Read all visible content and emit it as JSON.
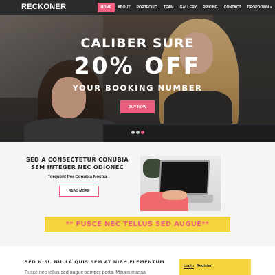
{
  "nav": {
    "logo": "RECKONER",
    "items": [
      {
        "label": "HOME",
        "active": true
      },
      {
        "label": "ABOUT",
        "active": false
      },
      {
        "label": "PORTFOLIO",
        "active": false
      },
      {
        "label": "TEAM",
        "active": false
      },
      {
        "label": "GALLERY",
        "active": false
      },
      {
        "label": "PRICING",
        "active": false
      },
      {
        "label": "CONTACT",
        "active": false
      },
      {
        "label": "DROPDOWN",
        "active": false
      }
    ]
  },
  "hero": {
    "title": "CALIBER SURE",
    "big": "20% OFF",
    "sub": "YOUR BOOKING NUMBER",
    "button": "BUY NOW",
    "slides": 3,
    "active_slide": 3
  },
  "feature": {
    "heading_line1": "SED A CONSECTETUR CONUBIA",
    "heading_line2": "SEM INTEGER NEC ODIONEC",
    "subheading": "Torquent Per Conubia Nostra",
    "button": "READ MORE"
  },
  "banner": {
    "text": "** FUSCE NEC TELLUS SED AUGUE**"
  },
  "bottom": {
    "heading": "SED NISI. NULLA QUIS SEM AT NIBH ELEMENTUM",
    "text": "Fusce nec tellus sed augue semper porta. Mauris massa.",
    "login_tab": "Login",
    "register_tab": "Register"
  },
  "colors": {
    "accent": "#ea5f7e",
    "yellow": "#f4d53f",
    "nav_bg": "#2b2b2b"
  }
}
